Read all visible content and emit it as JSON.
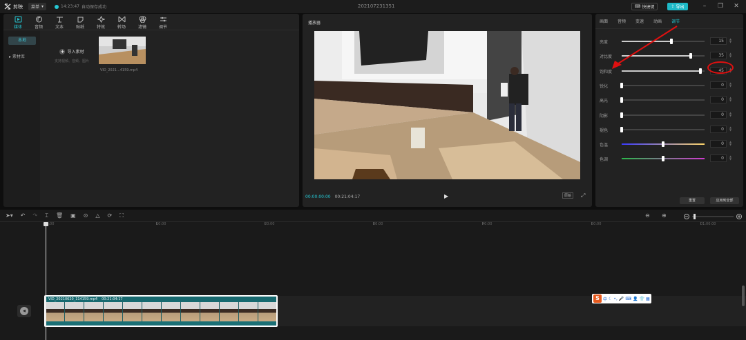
{
  "app": {
    "name": "剪映",
    "menu_label": "菜单",
    "save_time": "14:23:47",
    "save_status": "自动保存成功",
    "project_title": "202107231351",
    "shortcut_label": "快捷键",
    "export_label": "导出"
  },
  "media_panel": {
    "tabs": [
      {
        "label": "媒体",
        "icon": "media-icon",
        "active": true
      },
      {
        "label": "音频",
        "icon": "audio-icon",
        "active": false
      },
      {
        "label": "文本",
        "icon": "text-icon",
        "active": false
      },
      {
        "label": "贴纸",
        "icon": "sticker-icon",
        "active": false
      },
      {
        "label": "特效",
        "icon": "effects-icon",
        "active": false
      },
      {
        "label": "转场",
        "icon": "transition-icon",
        "active": false
      },
      {
        "label": "滤镜",
        "icon": "filter-icon",
        "active": false
      },
      {
        "label": "调节",
        "icon": "adjust-icon",
        "active": false
      }
    ],
    "side_local": "本地",
    "side_library": "素材库",
    "import_label": "导入素材",
    "import_hint": "支持视频、音频、图片",
    "thumb_name": "VID_2021...4159.mp4"
  },
  "player": {
    "title": "播放器",
    "current_time": "00:00:00:00",
    "total_time": "00:21:04:17",
    "ratio_label": "原始"
  },
  "adjust_panel": {
    "tabs": [
      {
        "label": "画面",
        "active": false
      },
      {
        "label": "音频",
        "active": false
      },
      {
        "label": "变速",
        "active": false
      },
      {
        "label": "动画",
        "active": false
      },
      {
        "label": "调节",
        "active": true
      }
    ],
    "rows": [
      {
        "label": "亮度",
        "value": "15",
        "level": 0.6
      },
      {
        "label": "对比度",
        "value": "35",
        "level": 0.83
      },
      {
        "label": "饱和度",
        "value": "45",
        "level": 0.95
      },
      {
        "label": "锐化",
        "value": "0",
        "level": 0.0
      },
      {
        "label": "高光",
        "value": "0",
        "level": 0.0
      },
      {
        "label": "阴影",
        "value": "0",
        "level": 0.0
      },
      {
        "label": "褪色",
        "value": "0",
        "level": 0.0
      },
      {
        "label": "色温",
        "value": "0",
        "level": 0.5
      },
      {
        "label": "色调",
        "value": "0",
        "level": 0.5
      }
    ],
    "reset_label": "重置",
    "apply_all_label": "应用到全部"
  },
  "timeline": {
    "ticks": [
      "00:00",
      "10:00",
      "20:00",
      "30:00",
      "40:00",
      "50:00",
      "01:00:00"
    ],
    "clip_name": "VID_20210620_114159.mp4",
    "clip_duration": "00:21:04:17"
  },
  "ime": {
    "logo": "S",
    "mode": "中"
  },
  "colors": {
    "accent": "#25c7d3",
    "annotation": "#e01010",
    "clip": "#1a6f75"
  }
}
